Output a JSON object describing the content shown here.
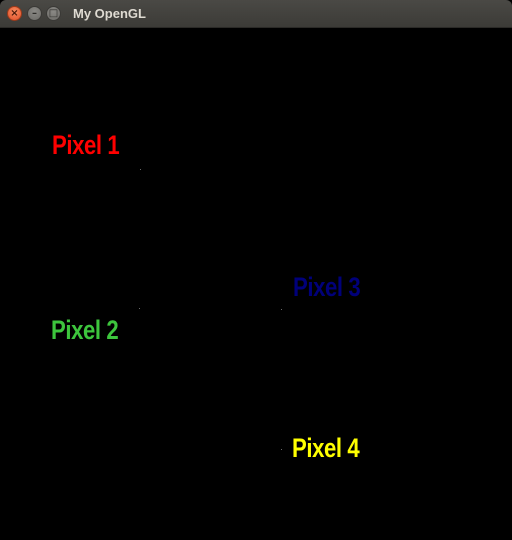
{
  "window": {
    "title": "My OpenGL",
    "controls": {
      "close_icon": "×",
      "minimize_icon": "–",
      "maximize_icon": "□"
    }
  },
  "labels": [
    {
      "text": "Pixel 1",
      "color": "#ff0000"
    },
    {
      "text": "Pixel 2",
      "color": "#3dc53d"
    },
    {
      "text": "Pixel 3",
      "color": "#00007a"
    },
    {
      "text": "Pixel 4",
      "color": "#ffff00"
    }
  ]
}
